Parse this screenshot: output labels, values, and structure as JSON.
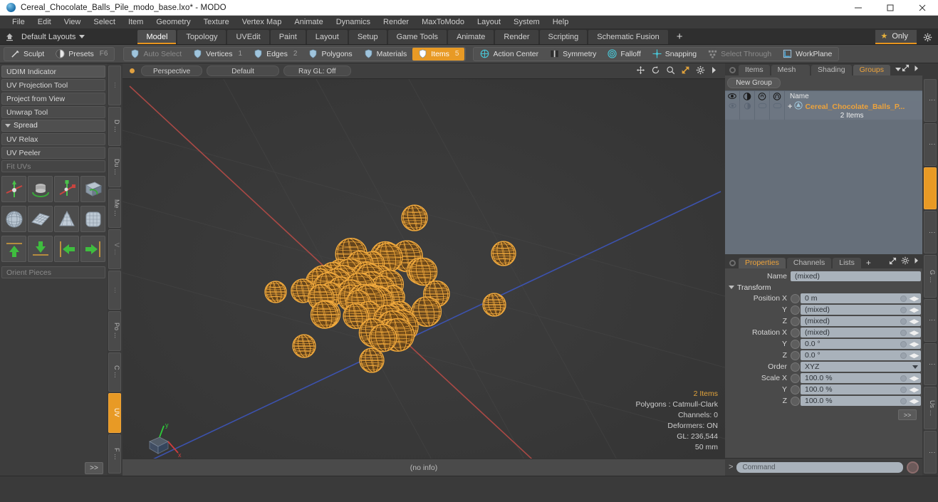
{
  "titlebar": {
    "title": "Cereal_Chocolate_Balls_Pile_modo_base.lxo* - MODO",
    "minimize": "−",
    "maximize": "□",
    "close": "✕"
  },
  "menubar": {
    "items": [
      "File",
      "Edit",
      "View",
      "Select",
      "Item",
      "Geometry",
      "Texture",
      "Vertex Map",
      "Animate",
      "Dynamics",
      "Render",
      "MaxToModo",
      "Layout",
      "System",
      "Help"
    ]
  },
  "layoutbar": {
    "home_icon": "home-icon",
    "layouts_label": "Default Layouts",
    "tabs": [
      {
        "label": "Model",
        "active": true
      },
      {
        "label": "Topology",
        "active": false
      },
      {
        "label": "UVEdit",
        "active": false
      },
      {
        "label": "Paint",
        "active": false
      },
      {
        "label": "Layout",
        "active": false
      },
      {
        "label": "Setup",
        "active": false
      },
      {
        "label": "Game Tools",
        "active": false
      },
      {
        "label": "Animate",
        "active": false
      },
      {
        "label": "Render",
        "active": false
      },
      {
        "label": "Scripting",
        "active": false
      },
      {
        "label": "Schematic Fusion",
        "active": false
      }
    ],
    "add_label": "+",
    "only_label": "Only",
    "gear_icon": "gear-icon"
  },
  "modebar": {
    "left_group": [
      {
        "label": "Sculpt",
        "icon": "sculpt-icon",
        "state": "normal",
        "num": ""
      },
      {
        "label": "Presets",
        "icon": "presets-icon",
        "state": "normal",
        "num": "F6"
      }
    ],
    "select_group": [
      {
        "label": "Auto Select",
        "icon": "shield-icon",
        "state": "dim",
        "num": ""
      },
      {
        "label": "Vertices",
        "icon": "shield-icon",
        "state": "normal",
        "num": "1"
      },
      {
        "label": "Edges",
        "icon": "shield-icon",
        "state": "normal",
        "num": "2"
      },
      {
        "label": "Polygons",
        "icon": "shield-icon",
        "state": "normal",
        "num": ""
      },
      {
        "label": "Materials",
        "icon": "shield-icon",
        "state": "normal",
        "num": ""
      },
      {
        "label": "Items",
        "icon": "shield-icon",
        "state": "on",
        "num": "5"
      }
    ],
    "right_group": [
      {
        "label": "Action Center",
        "icon": "action-center-icon",
        "state": "normal",
        "num": ""
      },
      {
        "label": "Symmetry",
        "icon": "symmetry-icon",
        "state": "normal",
        "num": ""
      },
      {
        "label": "Falloff",
        "icon": "falloff-icon",
        "state": "normal",
        "num": ""
      },
      {
        "label": "Snapping",
        "icon": "snapping-icon",
        "state": "normal",
        "num": ""
      },
      {
        "label": "Select Through",
        "icon": "select-through-icon",
        "state": "dim",
        "num": ""
      },
      {
        "label": "WorkPlane",
        "icon": "workplane-icon",
        "state": "normal",
        "num": ""
      }
    ]
  },
  "leftpanel": {
    "buttons": [
      {
        "label": "UDIM Indicator",
        "style": "group"
      },
      {
        "label": "UV Projection Tool",
        "style": "normal"
      },
      {
        "label": "Project from View",
        "style": "normal"
      },
      {
        "label": "Unwrap Tool",
        "style": "normal"
      }
    ],
    "section": "Spread",
    "buttons2": [
      {
        "label": "UV Relax",
        "style": "normal"
      },
      {
        "label": "UV Peeler",
        "style": "normal"
      },
      {
        "label": "Fit UVs",
        "style": "dim"
      }
    ],
    "tool_icons_row1": [
      "uv-move-icon",
      "uv-rotate-icon",
      "uv-scale-icon",
      "uv-flip-icon"
    ],
    "tool_icons_row2": [
      "uv-sphere-icon",
      "uv-plane-icon",
      "uv-cone-icon",
      "uv-cube-icon"
    ],
    "tool_icons_row3": [
      "arrow-up-icon",
      "arrow-down-icon",
      "arrow-left-icon",
      "arrow-right-icon"
    ],
    "orient_label": "Orient Pieces",
    "more_label": ">>",
    "vtabs": [
      {
        "label": "…",
        "active": false,
        "dim": true
      },
      {
        "label": "D …",
        "active": false,
        "dim": false
      },
      {
        "label": "Du …",
        "active": false,
        "dim": false
      },
      {
        "label": "Me …",
        "active": false,
        "dim": false
      },
      {
        "label": "V …",
        "active": false,
        "dim": true
      },
      {
        "label": "…",
        "active": false,
        "dim": true
      },
      {
        "label": "Po …",
        "active": false,
        "dim": false
      },
      {
        "label": "C …",
        "active": false,
        "dim": false
      },
      {
        "label": "UV",
        "active": true,
        "dim": false
      },
      {
        "label": "F …",
        "active": false,
        "dim": false
      }
    ]
  },
  "viewport": {
    "chips": [
      "Perspective",
      "Default",
      "Ray GL: Off"
    ],
    "tool_icons": [
      "pan-icon",
      "rotate-icon",
      "zoom-icon",
      "fit-icon",
      "gear-icon",
      "chevron-right-icon"
    ],
    "status": {
      "items": "2 Items",
      "polygons": "Polygons : Catmull-Clark",
      "channels": "Channels: 0",
      "deformers": "Deformers: ON",
      "gl": "GL: 236,544",
      "scale": "50 mm"
    },
    "footer": "(no info)",
    "axis_labels": [
      "y",
      "x"
    ]
  },
  "rightpanel": {
    "top": {
      "tabs": [
        {
          "label": "Items",
          "active": false
        },
        {
          "label": "Mesh …",
          "active": false
        },
        {
          "label": "Shading",
          "active": false
        },
        {
          "label": "Groups",
          "active": true
        }
      ],
      "dropdown_icon": "chevron-down-icon",
      "expand_icon": "expand-icon",
      "arrow_icon": "chevron-right-icon",
      "new_group_label": "New Group",
      "tree_header_icons": [
        "eye-icon",
        "render-icon",
        "lock-icon",
        "ghost-icon"
      ],
      "tree_header_name": "Name",
      "rows": [
        {
          "name": "Cereal_Chocolate_Balls_P...",
          "sub": "2 Items",
          "icon": "group-icon"
        }
      ]
    },
    "bottom": {
      "tabs": [
        {
          "label": "Properties",
          "active": true
        },
        {
          "label": "Channels",
          "active": false
        },
        {
          "label": "Lists",
          "active": false
        }
      ],
      "add_label": "+",
      "expand_icon": "expand-icon",
      "gear_icon": "gear-icon",
      "arrow_icon": "chevron-right-icon",
      "name_label": "Name",
      "name_value": "(mixed)",
      "transform_label": "Transform",
      "fields": [
        {
          "label": "Position X",
          "value": "0 m",
          "type": "num"
        },
        {
          "label": "Y",
          "value": "(mixed)",
          "type": "num"
        },
        {
          "label": "Z",
          "value": "(mixed)",
          "type": "num"
        },
        {
          "label": "Rotation X",
          "value": "(mixed)",
          "type": "num"
        },
        {
          "label": "Y",
          "value": "0.0 °",
          "type": "num"
        },
        {
          "label": "Z",
          "value": "0.0 °",
          "type": "num"
        },
        {
          "label": "Order",
          "value": "XYZ",
          "type": "dropdown"
        },
        {
          "label": "Scale X",
          "value": "100.0 %",
          "type": "num"
        },
        {
          "label": "Y",
          "value": "100.0 %",
          "type": "num"
        },
        {
          "label": "Z",
          "value": "100.0 %",
          "type": "num"
        }
      ],
      "more_label": ">>"
    },
    "vtabs": [
      {
        "label": "⋮",
        "active": false
      },
      {
        "label": "⋮",
        "active": false
      },
      {
        "label": "",
        "active": true
      },
      {
        "label": "⋮",
        "active": false
      },
      {
        "label": "G …",
        "active": false
      },
      {
        "label": "⋮",
        "active": false
      },
      {
        "label": "⋮",
        "active": false
      },
      {
        "label": "Us …",
        "active": false
      },
      {
        "label": "⋮",
        "active": false
      }
    ],
    "command": {
      "prompt": ">",
      "placeholder": "Command",
      "record_icon": "record-icon"
    }
  },
  "colors": {
    "accent": "#e89a25",
    "wire": "#f0a93c",
    "panel": "#4a4a4a",
    "field": "#a9b2bb"
  }
}
